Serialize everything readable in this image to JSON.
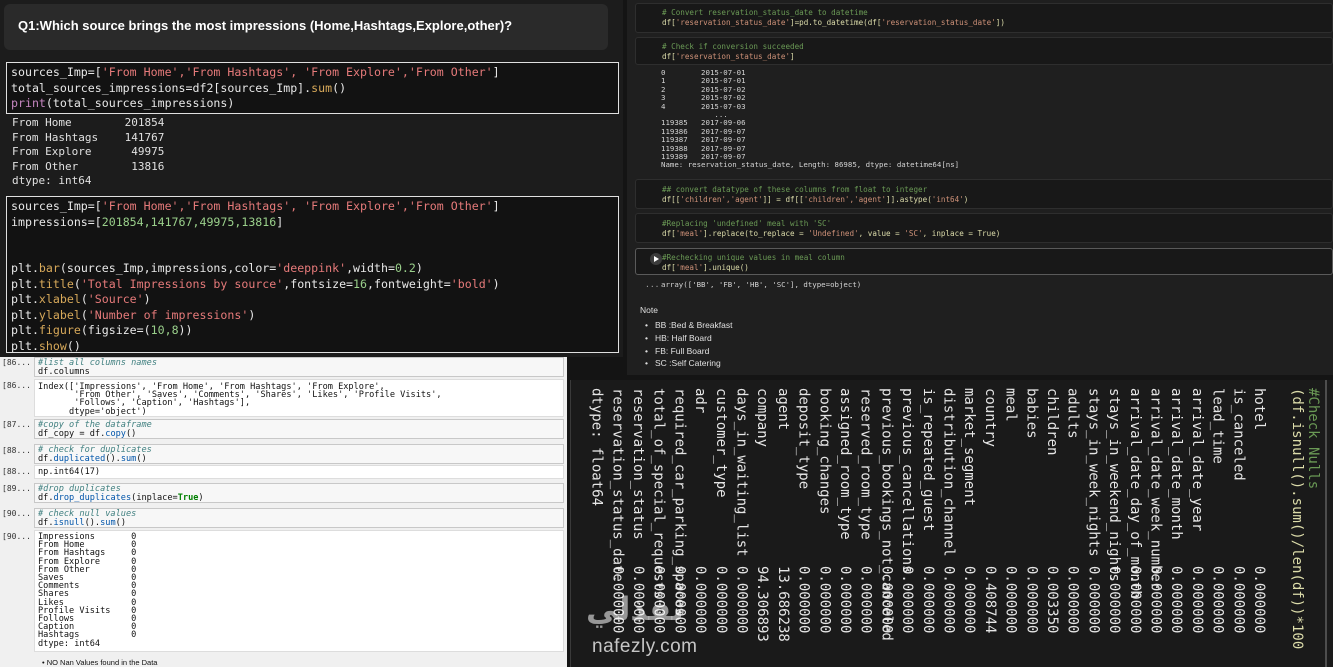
{
  "top_left": {
    "question": "Q1:Which source brings the most impressions (Home,Hashtags,Explore,other)?",
    "cell1": {
      "l1a": "sources_Imp=[",
      "l1s": "'From Home','From Hashtags', 'From Explore','From Other'",
      "l1b": "]",
      "l2a": "total_sources_impressions=df2[sources_Imp].",
      "l2f": "sum",
      "l2b": "()",
      "l3f": "print",
      "l3b": "(total_sources_impressions)"
    },
    "output1": "From Home        201854\nFrom Hashtags    141767\nFrom Explore      49975\nFrom Other        13816\ndtype: int64",
    "cell2": {
      "l1a": "sources_Imp=[",
      "l1s": "'From Home','From Hashtags', 'From Explore','From Other'",
      "l1b": "]",
      "l2a": "impressions=[",
      "l2n": "201854,141767,49975,13816",
      "l2b": "]",
      "l3a": "plt.",
      "l3f": "bar",
      "l3b": "(sources_Imp,impressions,color=",
      "l3s": "'deeppink'",
      "l3c": ",width=",
      "l3n": "0.2",
      "l3d": ")",
      "l4a": "plt.",
      "l4f": "title",
      "l4b": "(",
      "l4s": "'Total Impressions by source'",
      "l4c": ",fontsize=",
      "l4n": "16",
      "l4d": ",fontweight=",
      "l4s2": "'bold'",
      "l4e": ")",
      "l5a": "plt.",
      "l5f": "xlabel",
      "l5b": "(",
      "l5s": "'Source'",
      "l5c": ")",
      "l6a": "plt.",
      "l6f": "ylabel",
      "l6b": "(",
      "l6s": "'Number of impressions'",
      "l6c": ")",
      "l7a": "plt.",
      "l7f": "figure",
      "l7b": "(figsize=(",
      "l7n": "10,8",
      "l7c": "))",
      "l8a": "plt.",
      "l8f": "show",
      "l8b": "()"
    }
  },
  "top_right": {
    "c1_comment": "# Convert reservation_status_date to datetime",
    "c1_code_a": "df[",
    "c1_code_s": "'reservation_status_date'",
    "c1_code_b": "]=pd.to_datetime(df[",
    "c1_code_s2": "'reservation_status_date'",
    "c1_code_c": "])",
    "c2_comment": "# Check if conversion succeeded",
    "c2_code_a": "df[",
    "c2_code_s": "'reservation_status_date'",
    "c2_code_b": "]",
    "c2_output": "0        2015-07-01\n1        2015-07-01\n2        2015-07-02\n3        2015-07-02\n4        2015-07-03\n            ...\n119385   2017-09-06\n119386   2017-09-07\n119387   2017-09-07\n119388   2017-09-07\n119389   2017-09-07\nName: reservation_status_date, Length: 86985, dtype: datetime64[ns]",
    "c3_comment": "## convert datatype of these columns from float to integer",
    "c3_code_a": "df[[",
    "c3_code_s": "'children','agent'",
    "c3_code_b": "]] = df[[",
    "c3_code_s2": "'children','agent'",
    "c3_code_c": "]].astype(",
    "c3_code_s3": "'int64'",
    "c3_code_d": ")",
    "c4_comment": "#Replacing 'undefined' meal with 'SC'",
    "c4_code_a": "df[",
    "c4_code_s": "'meal'",
    "c4_code_b": "].replace(to_replace = ",
    "c4_code_s2": "'Undefined'",
    "c4_code_c": ", value = ",
    "c4_code_s3": "'SC'",
    "c4_code_d": ", inplace = True)",
    "c5_comment": "#Rechecking unique values in meal column",
    "c5_code_a": "df[",
    "c5_code_s": "'meal'",
    "c5_code_b": "].unique()",
    "c5_prompt": "...",
    "c5_output": "array(['BB', 'FB', 'HB', 'SC'], dtype=object)",
    "note_title": "Note",
    "note_items": [
      "BB :Bed & Breakfast",
      "HB: Half Board",
      "FB: Full Board",
      "SC :Self Catering"
    ]
  },
  "bottom_left": {
    "n1": "[86...",
    "c1_comment": "#list all columns names",
    "c1_code": "df.columns",
    "n2": "[86...",
    "o2": "Index(['Impressions', 'From Home', 'From Hashtags', 'From Explore',\n       'From Other', 'Saves', 'Comments', 'Shares', 'Likes', 'Profile Visits',\n       'Follows', 'Caption', 'Hashtags'],\n      dtype='object')",
    "n3": "[87...",
    "c3_comment": "#copy of the dataframe",
    "c3_code_a": "df_copy = df.",
    "c3_code_f": "copy",
    "c3_code_b": "()",
    "n4": "[88...",
    "c4_comment": "# check for duplicates",
    "c4_code_a": "df.",
    "c4_code_f": "duplicated",
    "c4_code_b": "().",
    "c4_code_f2": "sum",
    "c4_code_c": "()",
    "n5": "[88...",
    "o5": "np.int64(17)",
    "n6": "[89...",
    "c6_comment": "#drop duplicates",
    "c6_code_a": "df.",
    "c6_code_f": "drop_duplicates",
    "c6_code_b": "(inplace=",
    "c6_code_k": "True",
    "c6_code_c": ")",
    "n7": "[90...",
    "c7_comment": "# check null values",
    "c7_code_a": "df.",
    "c7_code_f": "isnull",
    "c7_code_b": "().",
    "c7_code_f2": "sum",
    "c7_code_c": "()",
    "n8": "[90...",
    "o8": "Impressions       0\nFrom Home         0\nFrom Hashtags     0\nFrom Explore      0\nFrom Other        0\nSaves             0\nComments          0\nShares            0\nLikes             0\nProfile Visits    0\nFollows           0\nCaption           0\nHashtags          0\ndtype: int64",
    "bullet": "•  NO Nan Values found in the Data"
  },
  "bottom_right": {
    "comment": "#Check Nulls",
    "code": "(df.isnull().sum()/len(df))*100",
    "columns": [
      "hotel",
      "is_canceled",
      "lead_time",
      "arrival_date_year",
      "arrival_date_month",
      "arrival_date_week_number",
      "arrival_date_day_of_month",
      "stays_in_weekend_nights",
      "stays_in_week_nights",
      "adults",
      "children",
      "babies",
      "meal",
      "country",
      "market_segment",
      "distribution_channel",
      "is_repeated_guest",
      "previous_cancellations",
      "previous_bookings_not_canceled",
      "reserved_room_type",
      "assigned_room_type",
      "booking_changes",
      "deposit_type",
      "agent",
      "company",
      "days_in_waiting_list",
      "customer_type",
      "adr",
      "required_car_parking_spaces",
      "total_of_special_requests",
      "reservation_status",
      "reservation_status_date",
      "dtype: float64"
    ],
    "values": [
      "0.000000",
      "0.000000",
      "0.000000",
      "0.000000",
      "0.000000",
      "0.000000",
      "0.000000",
      "0.000000",
      "0.000000",
      "0.000000",
      "0.003350",
      "0.000000",
      "0.000000",
      "0.408744",
      "0.000000",
      "0.000000",
      "0.000000",
      "0.000000",
      "0.000000",
      "0.000000",
      "0.000000",
      "0.000000",
      "0.000000",
      "13.686238",
      "94.306893",
      "0.000000",
      "0.000000",
      "0.000000",
      "0.000000",
      "0.000000",
      "0.000000",
      "0.000000"
    ]
  },
  "watermark": {
    "arabic": "نفذلي",
    "url": "nafezly.com"
  }
}
